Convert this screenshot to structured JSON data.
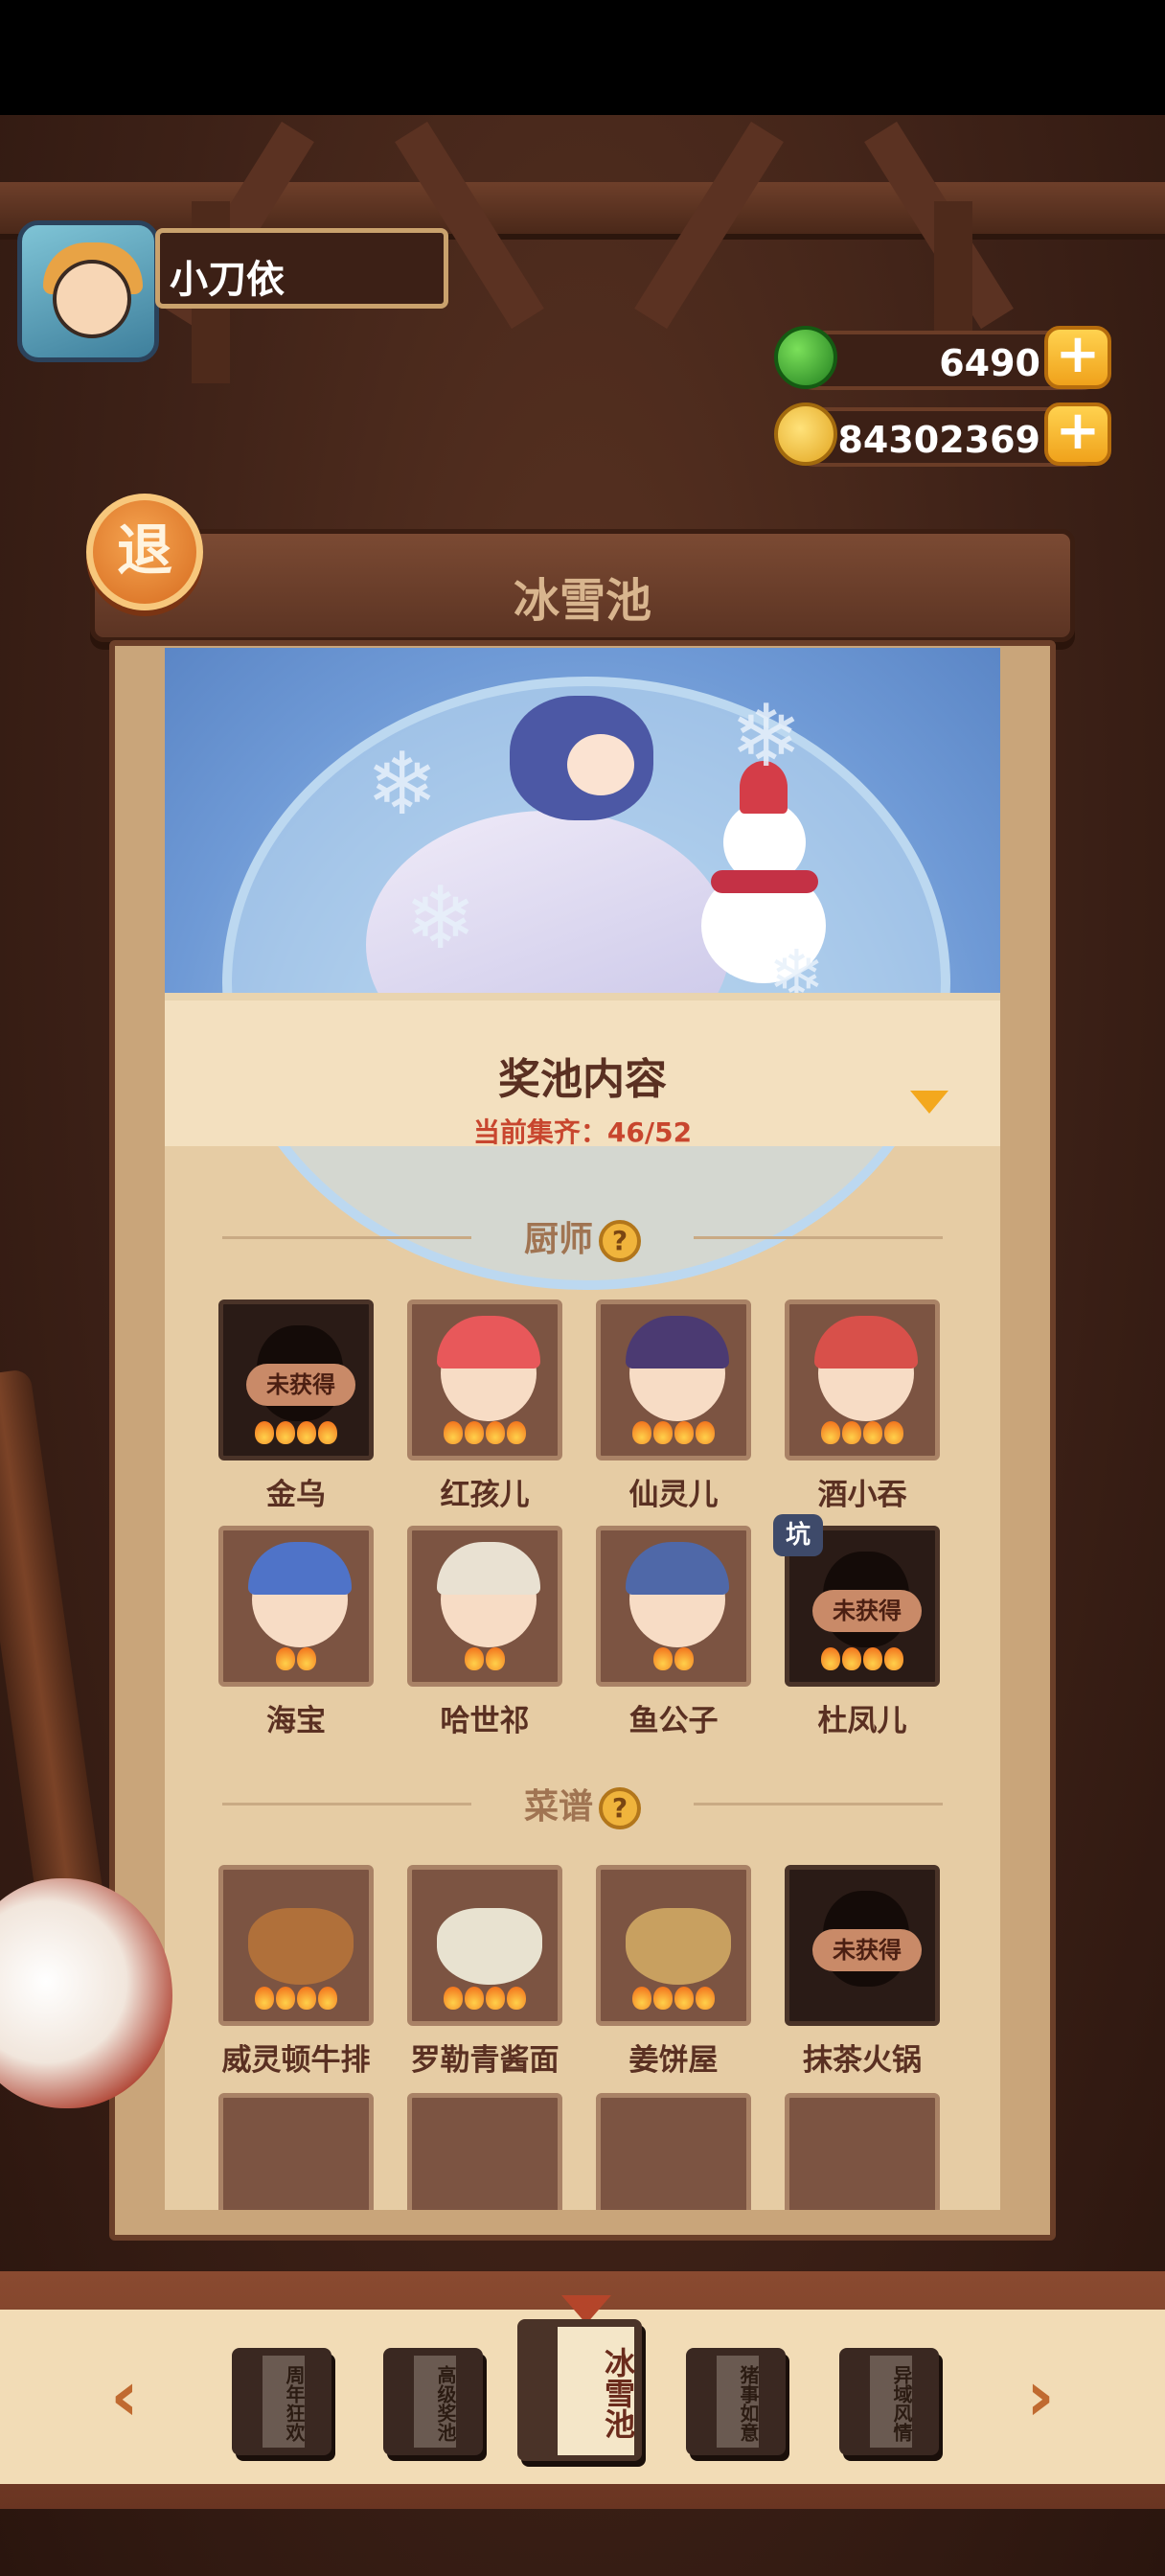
{
  "user": {
    "name": "小刀依"
  },
  "currencies": {
    "green_value": "6490",
    "gold_value": "84302369"
  },
  "exit_label": "退",
  "pool": {
    "title": "冰雪池",
    "content_title": "奖池内容",
    "progress": "当前集齐：46/52"
  },
  "sections": {
    "chefs_title": "厨师",
    "recipes_title": "菜谱",
    "help_glyph": "?"
  },
  "locked_label": "未获得",
  "pit_badge": "坑",
  "chefs": [
    {
      "name": "金乌",
      "locked": true
    },
    {
      "name": "红孩儿",
      "locked": false
    },
    {
      "name": "仙灵儿",
      "locked": false
    },
    {
      "name": "酒小吞",
      "locked": false
    },
    {
      "name": "海宝",
      "locked": false
    },
    {
      "name": "哈世祁",
      "locked": false
    },
    {
      "name": "鱼公子",
      "locked": false
    },
    {
      "name": "杜凤儿",
      "locked": true
    }
  ],
  "recipes": [
    {
      "name": "威灵顿牛排",
      "locked": false
    },
    {
      "name": "罗勒青酱面",
      "locked": false
    },
    {
      "name": "姜饼屋",
      "locked": false
    },
    {
      "name": "抹茶火锅",
      "locked": true
    }
  ],
  "pool_tabs": [
    {
      "label": "周年狂欢"
    },
    {
      "label": "高级奖池"
    },
    {
      "label": "冰雪池"
    },
    {
      "label": "猪事如意"
    },
    {
      "label": "异域风情"
    }
  ],
  "colors": {
    "accent": "#f0a21b",
    "panel": "#e6cca4",
    "progress_red": "#c8462e"
  }
}
